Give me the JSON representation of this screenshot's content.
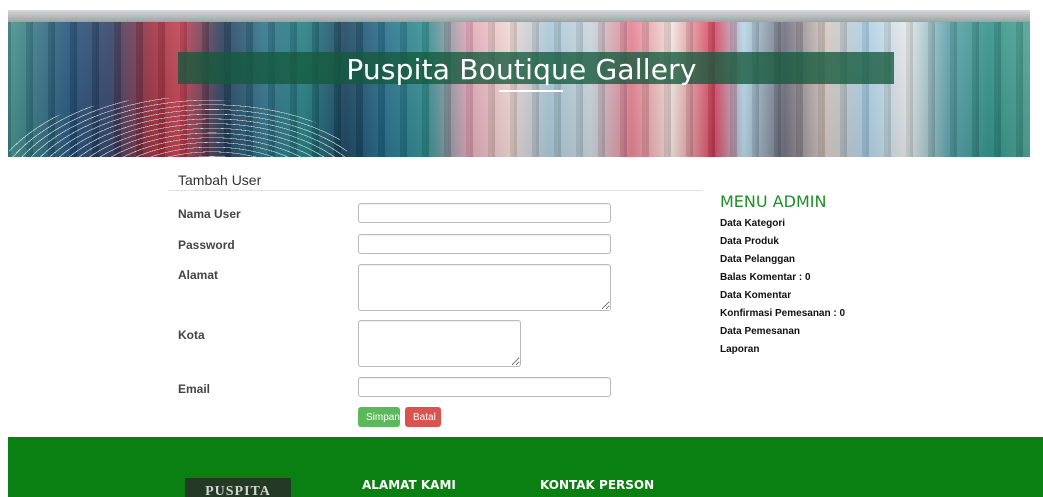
{
  "banner": {
    "title": "Puspita Boutique Gallery"
  },
  "form": {
    "heading": "Tambah User",
    "fields": [
      {
        "label": "Nama User",
        "value": ""
      },
      {
        "label": "Password",
        "value": ""
      },
      {
        "label": "Alamat",
        "value": ""
      },
      {
        "label": "Kota",
        "value": ""
      },
      {
        "label": "Email",
        "value": ""
      }
    ],
    "save_label": "Simpan",
    "cancel_label": "Batal"
  },
  "menu": {
    "title": "MENU ADMIN",
    "items": [
      "Data Kategori",
      "Data Produk",
      "Data Pelanggan",
      "Balas Komentar : 0",
      "Data Komentar",
      "Konfirmasi Pemesanan : 0",
      "Data Pemesanan",
      "Laporan"
    ]
  },
  "footer": {
    "logo_text": "PUSPITA",
    "address_heading": "ALAMAT KAMI",
    "contact_heading": "KONTAK PERSON"
  },
  "colors": {
    "brand_green": "#0a7f12",
    "save_button": "#5cb85c",
    "cancel_button": "#d9534f",
    "menu_title": "#1f8f2a"
  }
}
